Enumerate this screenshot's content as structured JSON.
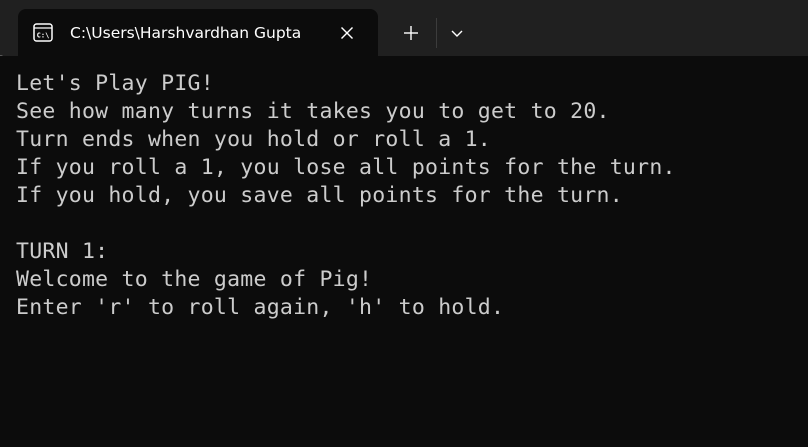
{
  "window": {
    "tab_title": "C:\\Users\\Harshvardhan Gupta",
    "tab_icon": "terminal-icon",
    "close_icon": "close-icon",
    "new_tab_icon": "plus-icon",
    "dropdown_icon": "chevron-down-icon"
  },
  "terminal": {
    "lines": [
      "Let's Play PIG!",
      "See how many turns it takes you to get to 20.",
      "Turn ends when you hold or roll a 1.",
      "If you roll a 1, you lose all points for the turn.",
      "If you hold, you save all points for the turn.",
      "",
      "TURN 1:",
      "Welcome to the game of Pig!",
      "Enter 'r' to roll again, 'h' to hold."
    ]
  },
  "colors": {
    "titlebar_bg": "#202020",
    "terminal_bg": "#0c0c0c",
    "text": "#cccccc"
  }
}
